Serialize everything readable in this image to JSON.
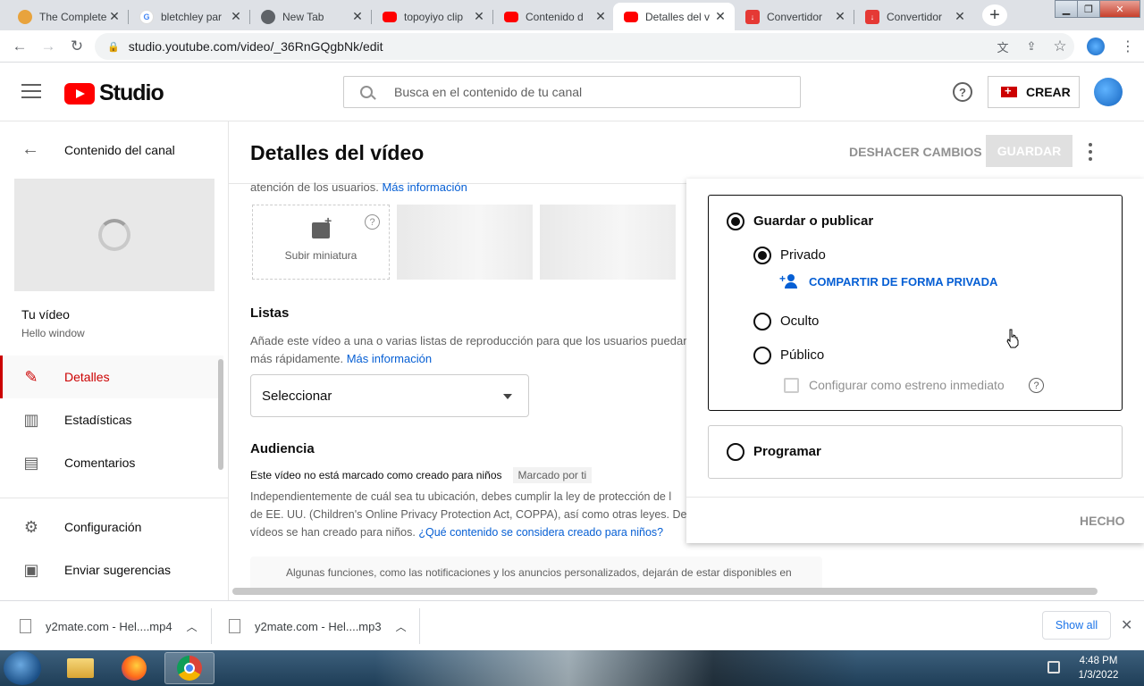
{
  "browser": {
    "tabs": [
      {
        "title": "The Complete",
        "favicon": "chrome-extension-icon",
        "color": "#e8a33d"
      },
      {
        "title": "bletchley par",
        "favicon": "google-icon",
        "color": "#4285f4"
      },
      {
        "title": "New Tab",
        "favicon": "chrome-icon",
        "color": "#5f6368"
      },
      {
        "title": "topoyiyo clip",
        "favicon": "youtube-icon",
        "color": "#ff0000"
      },
      {
        "title": "Contenido d",
        "favicon": "youtube-icon",
        "color": "#ff0000"
      },
      {
        "title": "Detalles del v",
        "favicon": "youtube-icon",
        "color": "#ff0000"
      },
      {
        "title": "Convertidor",
        "favicon": "download-icon",
        "color": "#e53935"
      },
      {
        "title": "Convertidor",
        "favicon": "download-icon",
        "color": "#e53935"
      }
    ],
    "url": "studio.youtube.com/video/_36RnGQgbNk/edit"
  },
  "header": {
    "logo_text": "Studio",
    "search_placeholder": "Busca en el contenido de tu canal",
    "create_label": "CREAR"
  },
  "sidebar": {
    "back_label": "Contenido del canal",
    "your_video": "Tu vídeo",
    "video_title": "Hello window",
    "items": [
      {
        "label": "Detalles",
        "icon": "pencil-icon"
      },
      {
        "label": "Estadísticas",
        "icon": "bar-chart-icon"
      },
      {
        "label": "Comentarios",
        "icon": "comment-icon"
      },
      {
        "label": "Configuración",
        "icon": "gear-icon"
      },
      {
        "label": "Enviar sugerencias",
        "icon": "feedback-icon"
      }
    ]
  },
  "main": {
    "title": "Detalles del vídeo",
    "undo_label": "DESHACER CAMBIOS",
    "save_label": "GUARDAR",
    "attention_text": "atención de los usuarios.",
    "more_info": "Más información",
    "upload_thumbnail": "Subir miniatura",
    "playlists": {
      "title": "Listas",
      "desc": "Añade este vídeo a una o varias listas de reproducción para que los usuarios puedan",
      "desc2": "más rápidamente.",
      "more_info": "Más información",
      "select_label": "Seleccionar"
    },
    "audience": {
      "title": "Audiencia",
      "status": "Este vídeo no está marcado como creado para niños",
      "badge": "Marcado por ti",
      "desc1": "Independientemente de cuál sea tu ubicación, debes cumplir la ley de protección de l",
      "desc2": "de EE. UU. (Children's Online Privacy Protection Act, COPPA), así como otras leyes. De",
      "desc3": "vídeos se han creado para niños.",
      "link": "¿Qué contenido se considera creado para niños?",
      "notice": "Algunas funciones, como las notificaciones y los anuncios personalizados, dejarán de estar disponibles en"
    }
  },
  "visibility": {
    "save_publish": "Guardar o publicar",
    "private": "Privado",
    "share_private": "COMPARTIR DE FORMA PRIVADA",
    "unlisted": "Oculto",
    "public": "Público",
    "premiere": "Configurar como estreno inmediato",
    "schedule": "Programar",
    "done": "HECHO",
    "selected_group": "Guardar o publicar",
    "selected_option": "Privado"
  },
  "downloads": {
    "items": [
      {
        "name": "y2mate.com - Hel....mp4"
      },
      {
        "name": "y2mate.com - Hel....mp3"
      }
    ],
    "show_all": "Show all"
  },
  "taskbar": {
    "time": "4:48 PM",
    "date": "1/3/2022"
  }
}
